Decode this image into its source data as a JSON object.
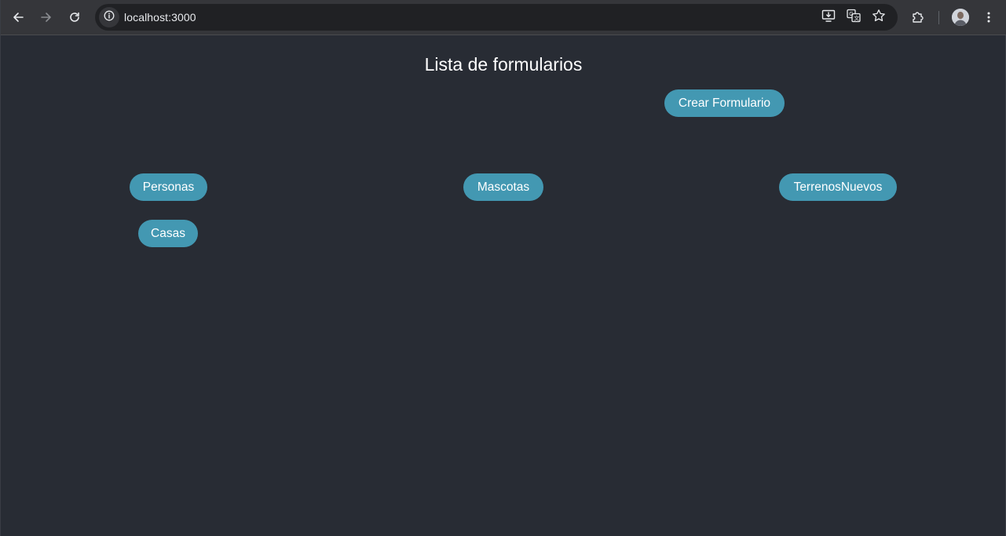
{
  "browser": {
    "url": "localhost:3000",
    "icons": {
      "back": "arrow-left-icon",
      "forward": "arrow-right-icon",
      "reload": "reload-icon",
      "site_info": "info-icon",
      "install": "install-app-icon",
      "translate": "translate-icon",
      "bookmark": "star-icon",
      "extensions": "puzzle-icon",
      "profile": "avatar",
      "menu": "kebab-menu-icon"
    }
  },
  "page": {
    "title": "Lista de formularios",
    "create_button": "Crear Formulario",
    "forms": [
      {
        "label": "Personas"
      },
      {
        "label": "Mascotas"
      },
      {
        "label": "TerrenosNuevos"
      },
      {
        "label": "Casas"
      }
    ]
  },
  "colors": {
    "background": "#282c34",
    "toolbar": "#35363a",
    "omnibox": "#202124",
    "button": "#4398b2",
    "text": "#ffffff"
  }
}
